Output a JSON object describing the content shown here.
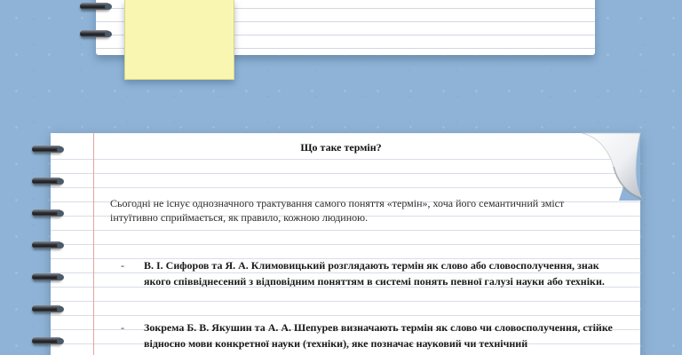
{
  "lesson": {
    "title": "Що таке термін?",
    "intro": "Сьогодні не існує однозначного трактування самого поняття «термін», хоча його семантичний зміст інтуїтивно сприймається, як правило, кожною людиною.",
    "bullet_marker": "-",
    "points": [
      "В. І. Сифоров та Я. А. Климовицький розглядають термін як слово або словосполучення, знак якого співвіднесений з відповідним поняттям в системі понять певної галузі науки або техніки.",
      "Зокрема Б. В. Якушин та А. А. Шепурев визначають термін як слово чи словосполучення, стійке відносно мови конкретної науки (техніки), яке позначає науковий чи технічний"
    ]
  },
  "colors": {
    "background": "#8fb3d6",
    "sticky_note": "#f8f6b0",
    "margin_line": "#e3a3a3",
    "ruled_line": "#d8dde6"
  }
}
